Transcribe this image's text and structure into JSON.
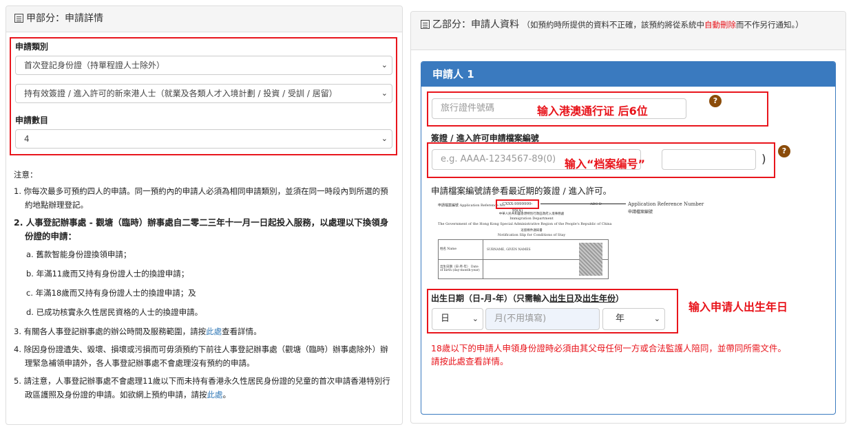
{
  "part_a": {
    "title": "甲部分：申請詳情",
    "type_label": "申請類別",
    "type_value": "首次登記身份證（持單程證人士除外）",
    "sub_value": "持有效簽證 / 進入許可的新來港人士（就業及各類人才入境計劃 / 投資 / 受訓 / 居留）",
    "count_label": "申請數目",
    "count_value": "4",
    "notes_title": "注意：",
    "notes": {
      "n1": "1. 你每次最多可預約四人的申請。同一預約內的申請人必須為相同申請類別，並須在同一時段內到所選的預約地點辦理登記。",
      "n2": "2. 人事登記辦事處 - 觀塘（臨時）辦事處自二零二三年十一月一日起投入服務，以處理以下換領身份證的申請：",
      "n2a": "a. 舊款智能身份證換領申請；",
      "n2b": "b. 年滿11歲而又持有身份證人士的換證申請；",
      "n2c": "c. 年滿18歲而又持有身份證人士的換證申請；及",
      "n2d": "d. 已成功核實永久性居民資格的人士的換證申請。",
      "n3_pre": "3. 有關各人事登記辦事處的辦公時間及服務範圍，請按",
      "n3_link": "此處",
      "n3_post": "查看詳情。",
      "n4": "4. 除因身份證遺失、毀壞、損壞或污損而可毋須預約下前往人事登記辦事處（觀塘（臨時）辦事處除外）辦理緊急補領申請外，各人事登記辦事處不會處理沒有預約的申請。",
      "n5_pre": "5. 請注意，人事登記辦事處不會處理11歲以下而未持有香港永久性居民身份證的兒童的首次申請香港特別行政區護照及身份證的申請。如欲網上預約申請，請按",
      "n5_link": "此處",
      "n5_post": "。"
    }
  },
  "part_b": {
    "title": "乙部分：申請人資料",
    "note_pre": "（如預約時所提供的資料不正確，該預約將從系統中",
    "note_red": "自動刪除",
    "note_post": "而不作另行通知。）",
    "applicant_header": "申請人 1",
    "travel_doc_placeholder": "旅行證件號碼",
    "travel_doc_annotation": "输入港澳通行证 后6位",
    "help_icon": "?",
    "file_no_label": "簽證 / 進入許可申請檔案編號",
    "file_no_placeholder": "e.g. AAAA-1234567-89(0)",
    "file_no_annotation": "输入“档案编号”",
    "paren_close": ")",
    "file_no_hint": "申請檔案編號請參看最近期的簽證 / 進入許可。",
    "sample": {
      "ref_label": "申請檔案編號 Application Reference No.",
      "ref_value": "CXXX-9999999-99(A)",
      "abc": "ABC-D",
      "side_en": "Application Reference Number",
      "side_zh": "申請檔案編號",
      "dept_zh": "中華人民共和國香港特別行政區政府入境事務處",
      "dept_en": "Immigration Department",
      "gov_en": "The Government of the Hong Kong Special Administrative Region of the People's Republic of China",
      "slip_zh": "逗留條件通知書",
      "slip_en": "Notification Slip for Conditions of Stay",
      "name_label": "姓名 Name",
      "name_value": "SURNAME, GIVEN NAMES",
      "dob_label": "出生日期（日-月-年） Date of birth (day-month-year)"
    },
    "dob_label": "出生日期（日-月-年）（只需輸入",
    "dob_u1": "出生日",
    "dob_and": "及",
    "dob_u2": "出生年份",
    "dob_close": "）",
    "day_value": "日",
    "month_placeholder": "月(不用填寫)",
    "year_value": "年",
    "dob_annotation": "输入申请人出生年日",
    "warning": "18歲以下的申請人申領身份證時必須由其父母任何一方或合法監護人陪同，並帶同所需文件。",
    "see_pre": "請按",
    "see_link": "此處",
    "see_post": "查看詳情。"
  },
  "colors": {
    "red": "#e8141b",
    "blue_header": "#3a7abf",
    "link": "#337ab7",
    "help_icon": "#8b4c0a"
  }
}
